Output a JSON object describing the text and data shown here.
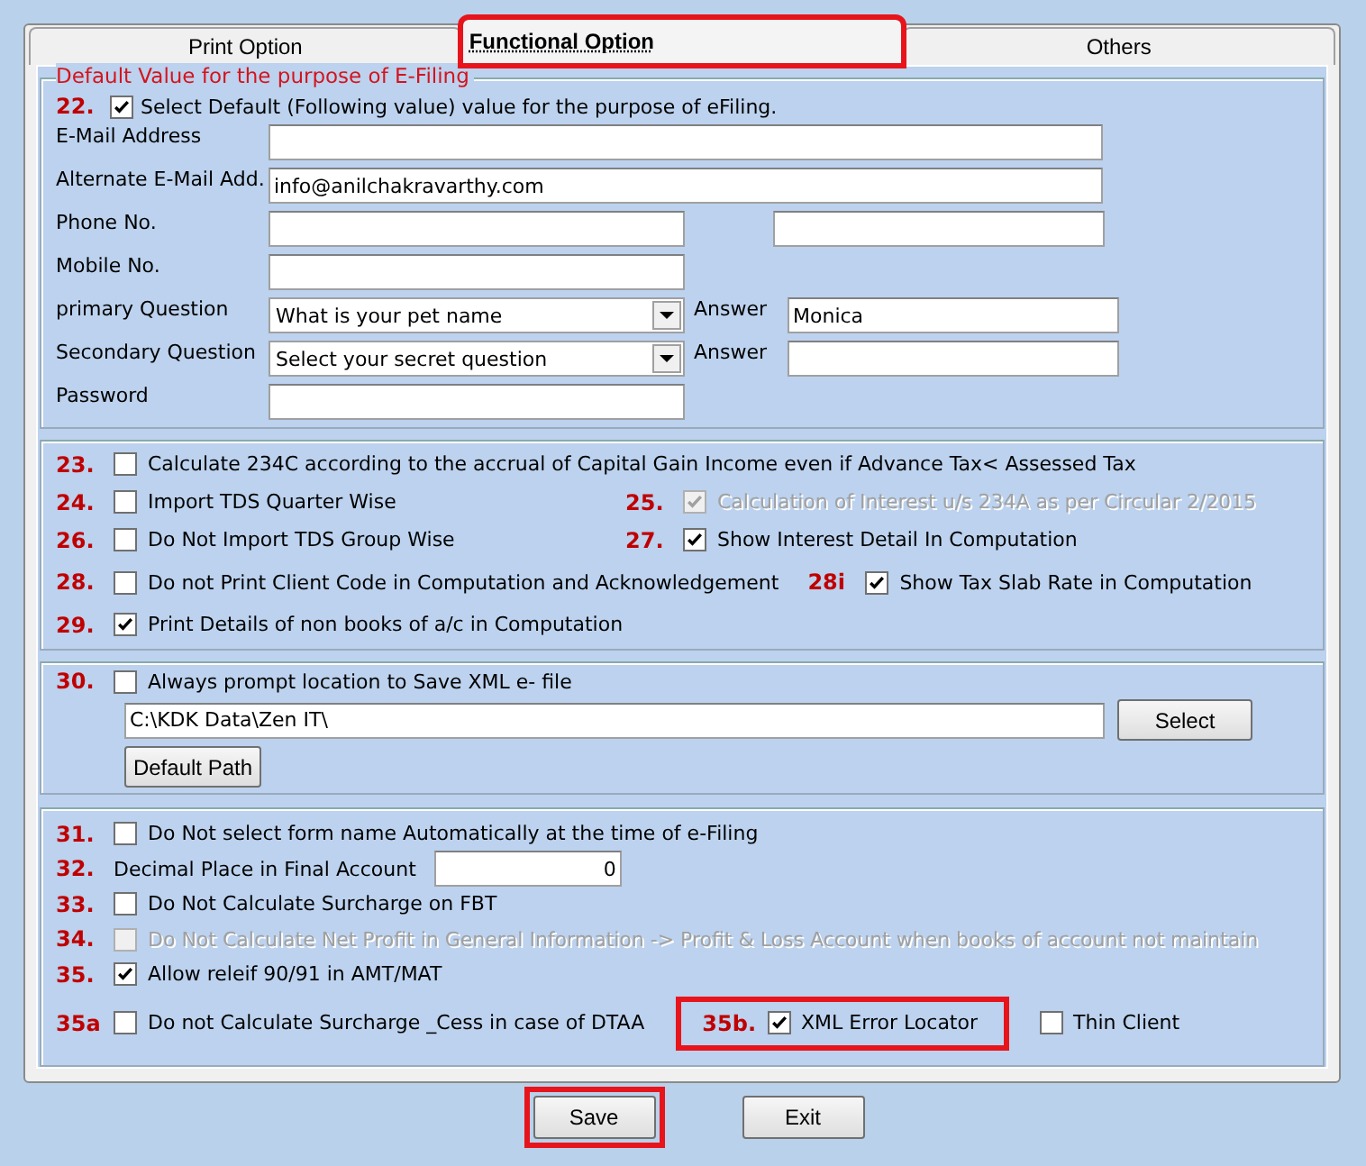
{
  "tabs": [
    {
      "label": "Print Option",
      "selected": false,
      "highlighted": false
    },
    {
      "label": "Functional Option",
      "selected": true,
      "highlighted": true
    },
    {
      "label": "Others",
      "selected": false,
      "highlighted": false
    }
  ],
  "efiling": {
    "legend": "Default Value for the purpose of E-Filing",
    "default_option": {
      "number": "22.",
      "checked": true,
      "label": "Select Default (Following value) value for the purpose of eFiling."
    },
    "fields": [
      {
        "label": "E-Mail Address",
        "inputs": [
          {
            "kind": "wide"
          }
        ]
      },
      {
        "label": "Alternate E-Mail Add.",
        "inputs": [
          {
            "kind": "wide",
            "value": "info@anilchakravarthy.com"
          }
        ]
      },
      {
        "label": "Phone No.",
        "inputs": [
          {
            "kind": "text"
          },
          {
            "kind": "side"
          }
        ]
      },
      {
        "label": "Mobile No.",
        "inputs": [
          {
            "kind": "text"
          }
        ]
      },
      {
        "label": "primary Question",
        "inputs": [
          {
            "kind": "select",
            "value": "What is your pet name"
          },
          {
            "kind": "answer",
            "label": "Answer",
            "value": "Monica"
          }
        ]
      },
      {
        "label": "Secondary Question",
        "inputs": [
          {
            "kind": "select",
            "value": "Select your secret question"
          },
          {
            "kind": "answer",
            "label": "Answer"
          }
        ]
      },
      {
        "label": "Password",
        "inputs": [
          {
            "kind": "text"
          }
        ]
      }
    ]
  },
  "options": [
    [
      {
        "number": "23.",
        "checked": false,
        "disabled": false,
        "label": "Calculate 234C according to the accrual of Capital Gain Income even if Advance Tax< Assessed Tax"
      }
    ],
    [
      {
        "number": "24.",
        "checked": false,
        "disabled": false,
        "label": "Import TDS Quarter Wise"
      },
      {
        "number": "25.",
        "checked": true,
        "disabled": true,
        "label": "Calculation of Interest u/s 234A as per Circular 2/2015"
      }
    ],
    [
      {
        "number": "26.",
        "checked": false,
        "disabled": false,
        "label": "Do Not Import TDS Group Wise"
      },
      {
        "number": "27.",
        "checked": true,
        "disabled": false,
        "label": "Show Interest Detail In Computation"
      }
    ],
    [
      {
        "number": "28.",
        "checked": false,
        "disabled": false,
        "label": "Do not Print Client Code in Computation and Acknowledgement"
      },
      {
        "number": "28i",
        "checked": true,
        "disabled": false,
        "label": "Show Tax Slab Rate in Computation"
      }
    ],
    [
      {
        "number": "29.",
        "checked": true,
        "disabled": false,
        "label": "Print Details of non books of a/c in Computation"
      }
    ]
  ],
  "xml": {
    "number": "30.",
    "checked": false,
    "label": "Always prompt location to Save XML e- file",
    "path": "C:\\KDK Data\\Zen IT\\",
    "select_button": "Select",
    "default_button": "Default Path"
  },
  "misc": [
    [
      {
        "kind": "check",
        "number": "31.",
        "checked": false,
        "disabled": false,
        "highlighted": false,
        "label": "Do Not select form name Automatically at the time of e-Filing"
      }
    ],
    [
      {
        "kind": "field",
        "number": "32.",
        "label": "Decimal Place in Final Account",
        "value": "0"
      }
    ],
    [
      {
        "kind": "check",
        "number": "33.",
        "checked": false,
        "disabled": false,
        "highlighted": false,
        "label": "Do Not Calculate Surcharge on FBT"
      }
    ],
    [
      {
        "kind": "check",
        "number": "34.",
        "checked": false,
        "disabled": true,
        "highlighted": false,
        "label": "Do Not  Calculate Net Profit in General Information -> Profit & Loss Account when books of account not maintain"
      }
    ],
    [
      {
        "kind": "check",
        "number": "35.",
        "checked": true,
        "disabled": false,
        "highlighted": false,
        "label": "Allow releif 90/91 in AMT/MAT"
      }
    ],
    [
      {
        "kind": "check",
        "number": "35a",
        "checked": false,
        "disabled": false,
        "highlighted": false,
        "label": "Do not Calculate Surcharge _Cess in case of DTAA"
      },
      {
        "kind": "check",
        "number": "35b.",
        "checked": true,
        "disabled": false,
        "highlighted": true,
        "label": "XML Error Locator"
      },
      {
        "kind": "check",
        "checked": false,
        "disabled": false,
        "highlighted": false,
        "label": "Thin Client"
      }
    ]
  ],
  "buttons": [
    {
      "label": "Save",
      "highlighted": true
    },
    {
      "label": "Exit",
      "highlighted": false
    }
  ]
}
